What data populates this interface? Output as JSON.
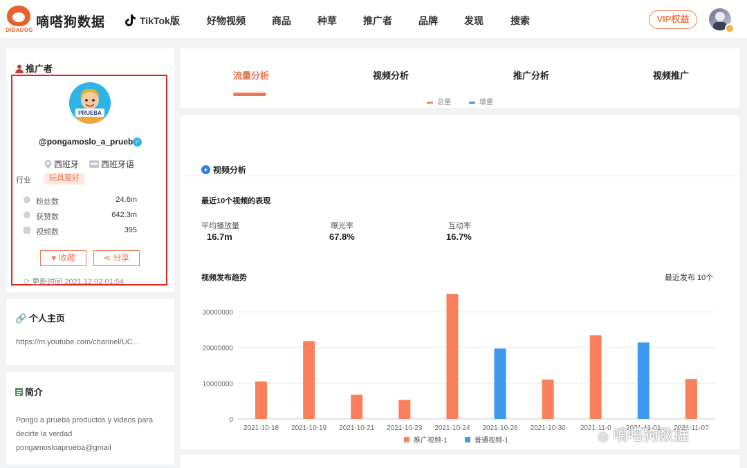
{
  "header": {
    "logo_sub": "DIDADOG",
    "brand": "嘀嗒狗数据",
    "nav": [
      {
        "label": "TikTok版",
        "left": 0
      },
      {
        "label": "好物视频"
      },
      {
        "label": "商品"
      },
      {
        "label": "种草"
      },
      {
        "label": "推广者"
      },
      {
        "label": "品牌"
      },
      {
        "label": "发现"
      },
      {
        "label": "搜索"
      }
    ],
    "vip": "VIP权益"
  },
  "profile": {
    "section_title": "推广者",
    "avatar_text": "PRUEBA",
    "username": "@pongamoslo_a_prueba",
    "country": "西班牙",
    "language": "西班牙语",
    "industry_label": "行业",
    "industry_tag": "玩具爱好",
    "stats": [
      {
        "label": "粉丝数",
        "value": "24.6m"
      },
      {
        "label": "获赞数",
        "value": "642.3m"
      },
      {
        "label": "视频数",
        "value": "395"
      }
    ],
    "collect_label": "收藏",
    "share_label": "分享",
    "update_time": "更新时间 2021.12.02 01:54"
  },
  "homepage": {
    "title": "个人主页",
    "url": "https://m.youtube.com/channel/UC..."
  },
  "intro": {
    "title": "简介",
    "lines": [
      "Pongo a prueba productos y videos para",
      "decirte la verdad",
      "pongamosloaprueba@gmail"
    ]
  },
  "tabs": {
    "items": [
      "流量分析",
      "视频分析",
      "推广分析",
      "视频推广"
    ],
    "active": 0
  },
  "mini_legend": {
    "total": "总量",
    "increment": "增量"
  },
  "video_analysis": {
    "title": "视频分析",
    "subtitle": "最近10个视频的表现",
    "kpis": [
      {
        "label": "平均播放量",
        "value": "16.7m"
      },
      {
        "label": "曝光率",
        "value": "67.8%"
      },
      {
        "label": "互动率",
        "value": "16.7%"
      }
    ],
    "chart_title": "视频发布趋势",
    "recent_label": "最近发布 10个"
  },
  "colors": {
    "accent": "#ee7551",
    "promo_bar": "#f9805b",
    "normal_bar": "#3d98ef"
  },
  "chart_data": {
    "type": "bar",
    "title": "视频发布趋势",
    "categories": [
      "2021-10-18",
      "2021-10-19",
      "2021-10-21",
      "2021-10-23",
      "2021-10-24",
      "2021-10-26",
      "2021-10-30",
      "2021-11-0",
      "2021-11-01",
      "2021-11-0?"
    ],
    "series": [
      {
        "name": "推广视频-1",
        "color": "#f9805b",
        "values": [
          10500000,
          21800000,
          6800000,
          5300000,
          35000000,
          null,
          11000000,
          23400000,
          null,
          11200000
        ]
      },
      {
        "name": "普通视频-1",
        "color": "#3d98ef",
        "values": [
          null,
          null,
          null,
          null,
          null,
          19700000,
          null,
          null,
          21400000,
          null
        ]
      }
    ],
    "yticks": [
      0,
      10000000,
      20000000,
      30000000
    ],
    "ylim": [
      0,
      36000000
    ],
    "legend": "bottom"
  },
  "watermark": "嘀嗒狗数据"
}
